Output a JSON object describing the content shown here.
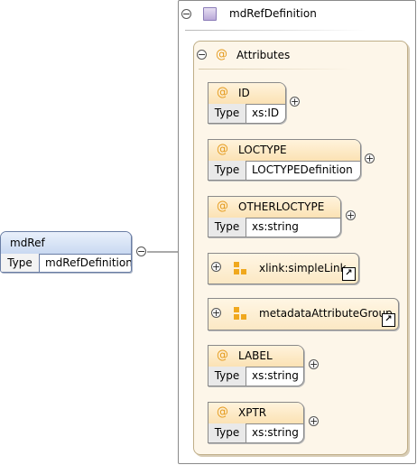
{
  "element": {
    "name": "mdRef",
    "type_label": "Type",
    "type_value": "mdRefDefinition"
  },
  "complex_type": {
    "name": "mdRefDefinition",
    "icon": "complex-type-icon"
  },
  "attributes_group": {
    "label": "Attributes",
    "at_symbol": "@"
  },
  "attributes": [
    {
      "name": "ID",
      "type_label": "Type",
      "type_value": "xs:ID"
    },
    {
      "name": "LOCTYPE",
      "type_label": "Type",
      "type_value": "LOCTYPEDefinition"
    },
    {
      "name": "OTHERLOCTYPE",
      "type_label": "Type",
      "type_value": "xs:string"
    },
    {
      "name": "LABEL",
      "type_label": "Type",
      "type_value": "xs:string"
    },
    {
      "name": "XPTR",
      "type_label": "Type",
      "type_value": "xs:string"
    }
  ],
  "refs": [
    {
      "name": "xlink:simpleLink",
      "icon": "attribute-group-icon"
    },
    {
      "name": "metadataAttributeGroup",
      "icon": "attribute-group-icon"
    }
  ],
  "symbols": {
    "expand": "+",
    "collapse": "−",
    "link": "↗"
  }
}
